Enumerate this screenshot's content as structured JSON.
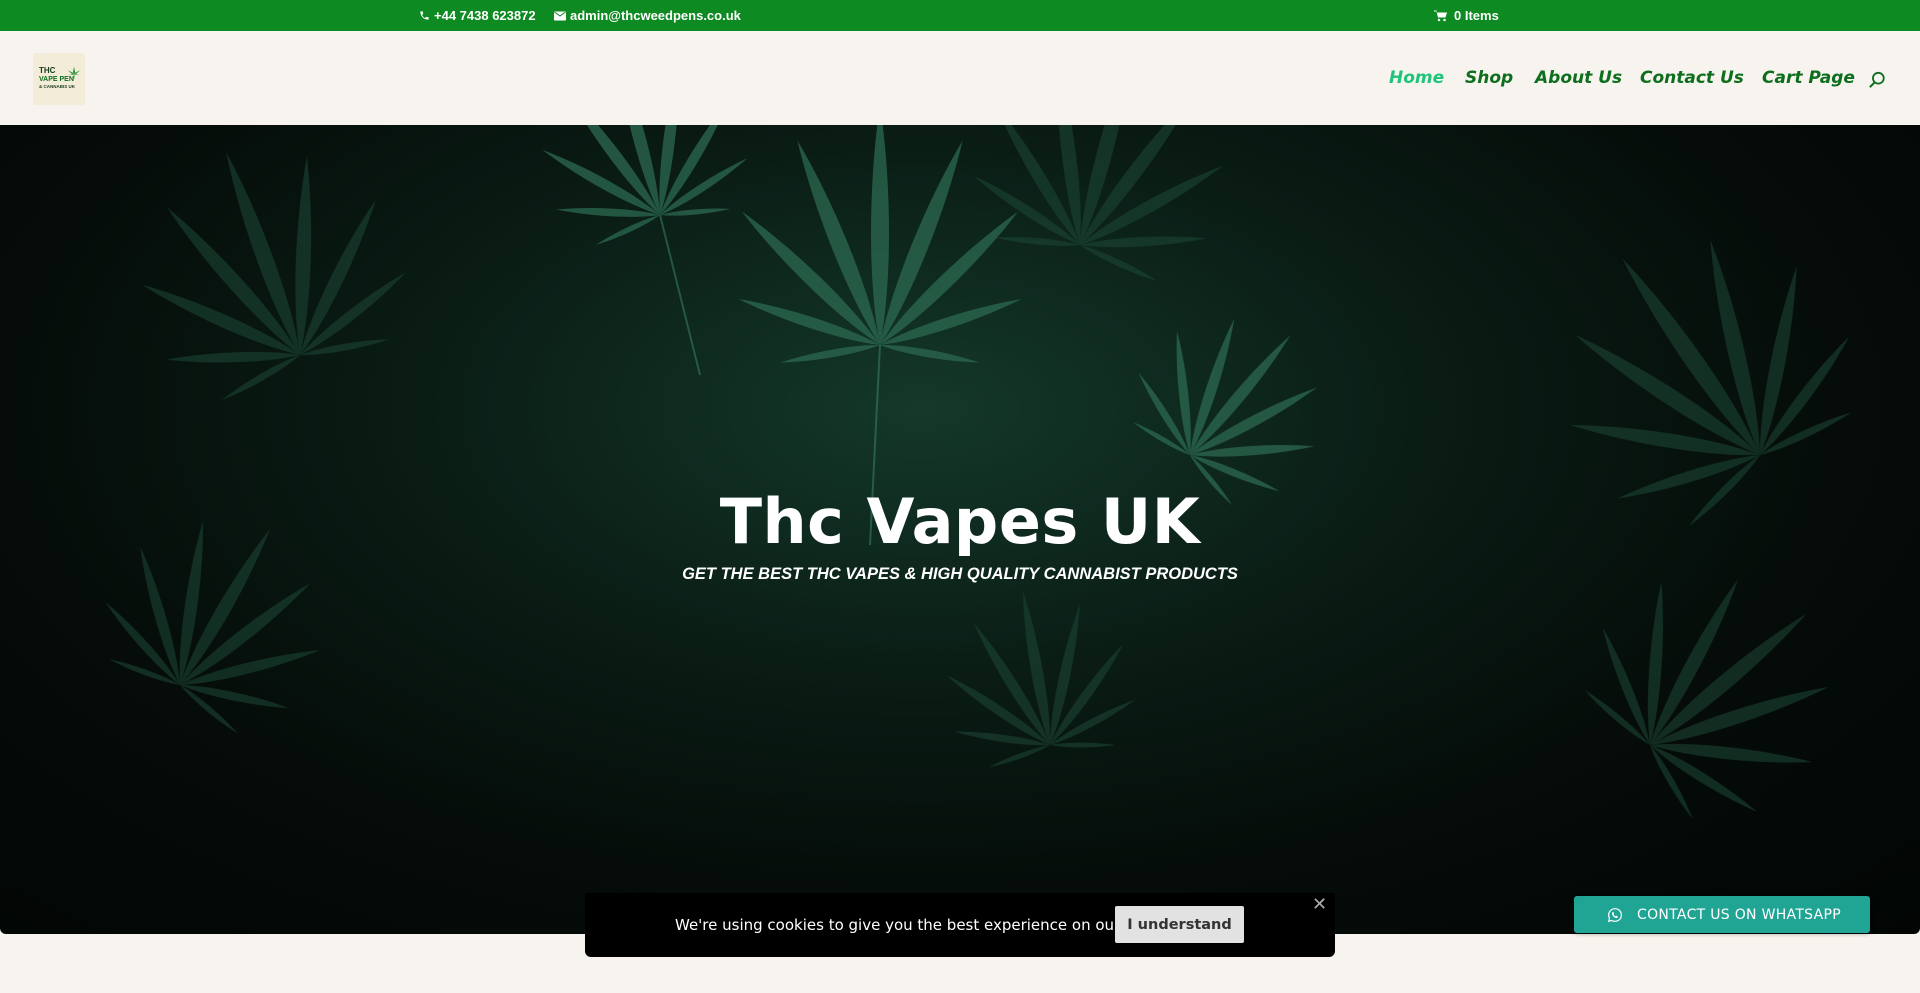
{
  "topbar": {
    "phone": "+44 7438 623872",
    "email": "admin@thcweedpens.co.uk",
    "cart": "0 Items",
    "bg_color": "#0d8a22"
  },
  "header": {
    "logo": {
      "line1": "THC",
      "line2": "VAPE PEN",
      "line3": "& CANNABIS UK"
    },
    "nav": [
      {
        "label": "Home",
        "active": true
      },
      {
        "label": "Shop"
      },
      {
        "label": "About Us"
      },
      {
        "label": "Contact Us"
      },
      {
        "label": "Cart Page"
      }
    ],
    "nav_color": "#0d6e1d",
    "active_color": "#1fc47a",
    "search_icon": "search-icon"
  },
  "hero": {
    "title": "Thc Vapes UK",
    "subtitle": "GET THE BEST THC VAPES & HIGH QUALITY CANNABIST PRODUCTS"
  },
  "cookie": {
    "text": " We're using cookies to give you the best experience on our site.",
    "button": "I understand",
    "close_icon": "close-icon"
  },
  "whatsapp": {
    "label": "CONTACT US ON WHATSAPP",
    "icon": "whatsapp-icon",
    "color": "#20a595"
  }
}
